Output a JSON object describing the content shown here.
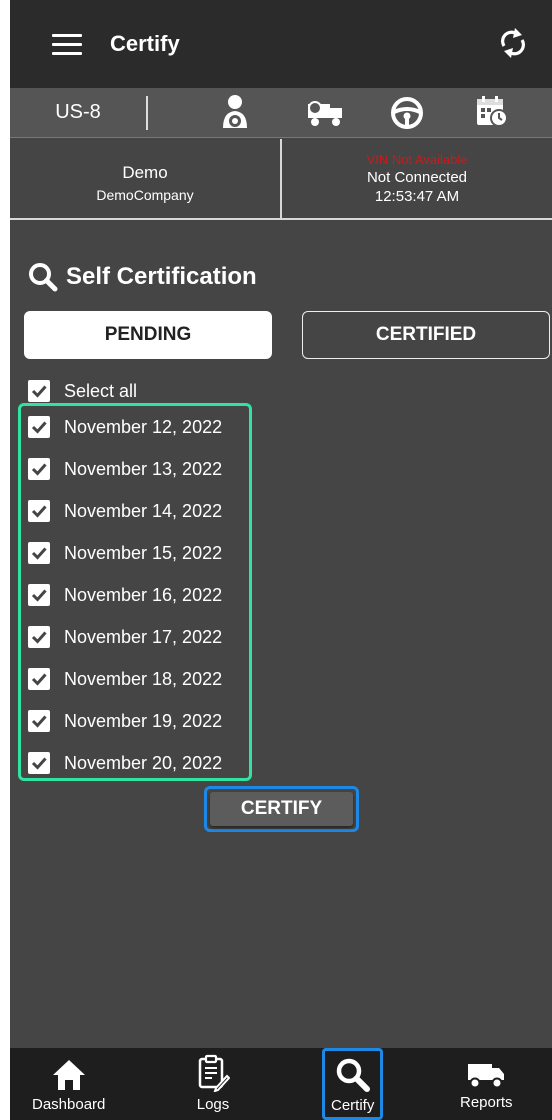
{
  "app": {
    "title": "Certify"
  },
  "status": {
    "ruleset": "US-8"
  },
  "info": {
    "driver": "Demo",
    "company": "DemoCompany",
    "vin": "VIN Not Available",
    "connection": "Not Connected",
    "time": "12:53:47 AM"
  },
  "section": {
    "title": "Self Certification"
  },
  "tabs": {
    "pending": "PENDING",
    "certified": "CERTIFIED"
  },
  "select_all": "Select all",
  "dates": [
    "November 12, 2022",
    "November 13, 2022",
    "November 14, 2022",
    "November 15, 2022",
    "November 16, 2022",
    "November 17, 2022",
    "November 18, 2022",
    "November 19, 2022",
    "November 20, 2022"
  ],
  "certify_button": "CERTIFY",
  "nav": {
    "dashboard": "Dashboard",
    "logs": "Logs",
    "certify": "Certify",
    "reports": "Reports"
  },
  "colors": {
    "accent_blue": "#1e88e5",
    "highlight_green": "#2fe3a2",
    "vin_red": "#cc1a1a",
    "background": "#454545"
  }
}
